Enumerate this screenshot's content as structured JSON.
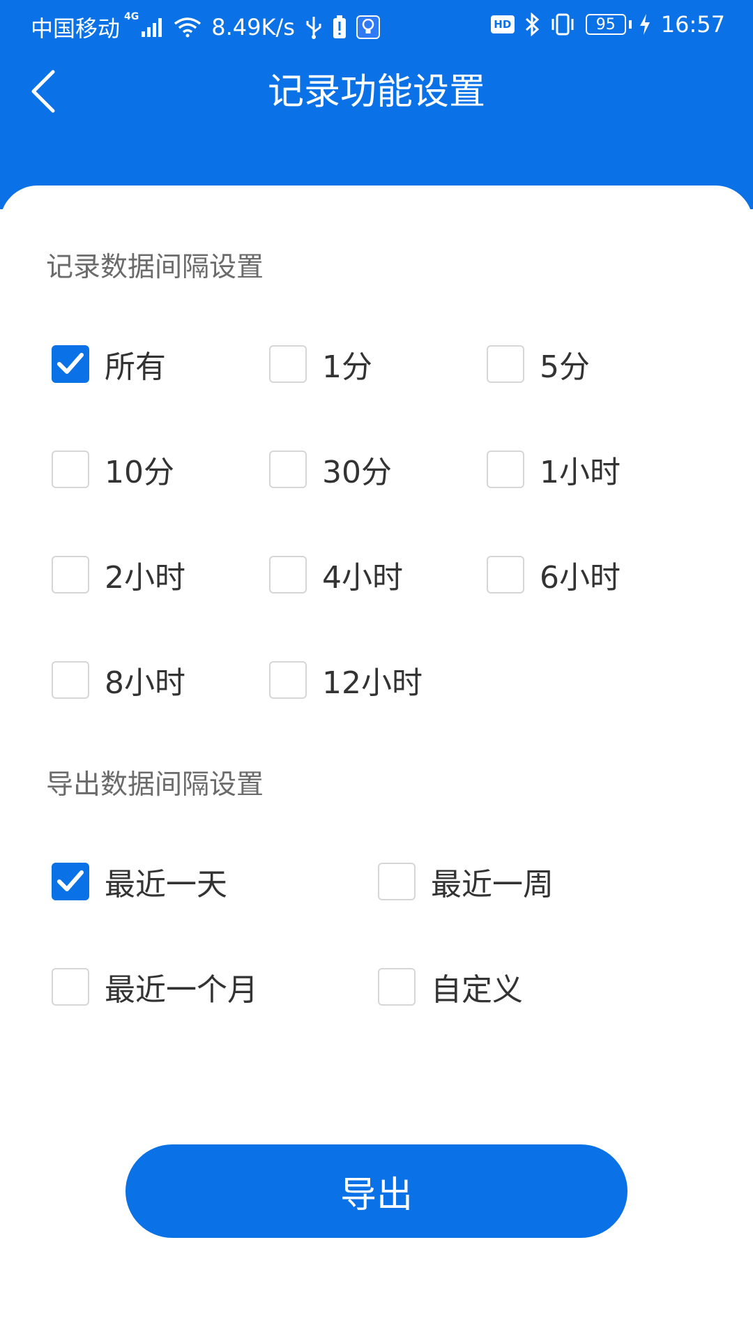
{
  "status_bar": {
    "carrier": "中国移动",
    "network_type": "4G",
    "net_speed": "8.49K/s",
    "battery_level": "95",
    "time": "16:57",
    "hd_label": "HD"
  },
  "header": {
    "title": "记录功能设置",
    "background_color": "#0a72e6"
  },
  "record_interval": {
    "title": "记录数据间隔设置",
    "options": [
      {
        "label": "所有",
        "checked": true
      },
      {
        "label": "1分",
        "checked": false
      },
      {
        "label": "5分",
        "checked": false
      },
      {
        "label": "10分",
        "checked": false
      },
      {
        "label": "30分",
        "checked": false
      },
      {
        "label": "1小时",
        "checked": false
      },
      {
        "label": "2小时",
        "checked": false
      },
      {
        "label": "4小时",
        "checked": false
      },
      {
        "label": "6小时",
        "checked": false
      },
      {
        "label": "8小时",
        "checked": false
      },
      {
        "label": "12小时",
        "checked": false
      }
    ]
  },
  "export_interval": {
    "title": "导出数据间隔设置",
    "options": [
      {
        "label": "最近一天",
        "checked": true
      },
      {
        "label": "最近一周",
        "checked": false
      },
      {
        "label": "最近一个月",
        "checked": false
      },
      {
        "label": "自定义",
        "checked": false
      }
    ]
  },
  "export_button": {
    "label": "导出"
  },
  "colors": {
    "accent": "#0a72e6",
    "section_title": "#6b6b6b",
    "option_text": "#333333"
  }
}
